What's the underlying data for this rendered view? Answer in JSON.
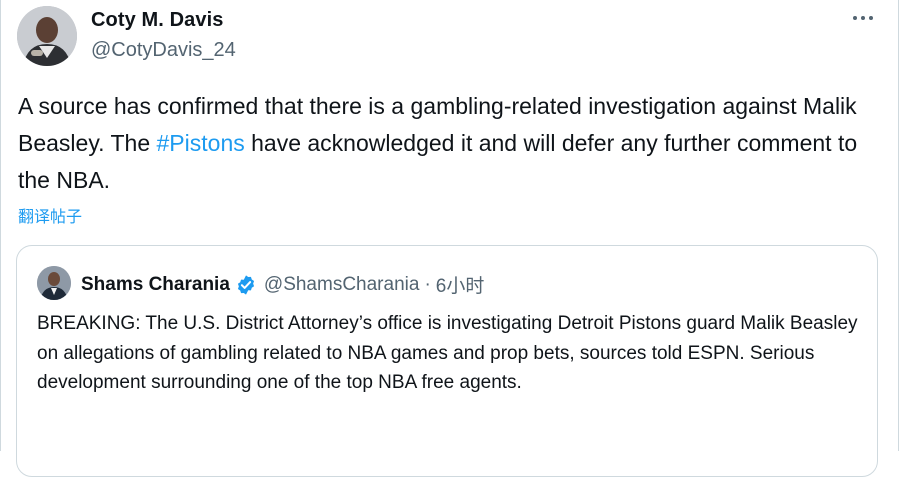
{
  "author": {
    "name": "Coty M. Davis",
    "handle": "@CotyDavis_24"
  },
  "tweet": {
    "text_before": "A source has confirmed that there is a gambling-related investigation against Malik Beasley. The ",
    "hashtag": "#Pistons",
    "text_after": " have acknowledged it and will defer any further comment to the NBA.",
    "translate_label": "翻译帖子"
  },
  "quote": {
    "name": "Shams Charania",
    "handle": "@ShamsCharania",
    "separator": "·",
    "time": "6小时",
    "text": "BREAKING: The U.S. District Attorney’s office is investigating Detroit Pistons guard Malik Beasley on allegations of gambling related to NBA games and prop bets, sources told ESPN. Serious development surrounding one of the top NBA free agents."
  },
  "colors": {
    "link": "#1d9bf0",
    "text": "#0f1419",
    "secondary": "#536471",
    "border": "#cfd9de",
    "verified": "#1d9bf0"
  },
  "icons": {
    "more": "more-horizontal-icon",
    "verified": "verified-badge-icon"
  }
}
